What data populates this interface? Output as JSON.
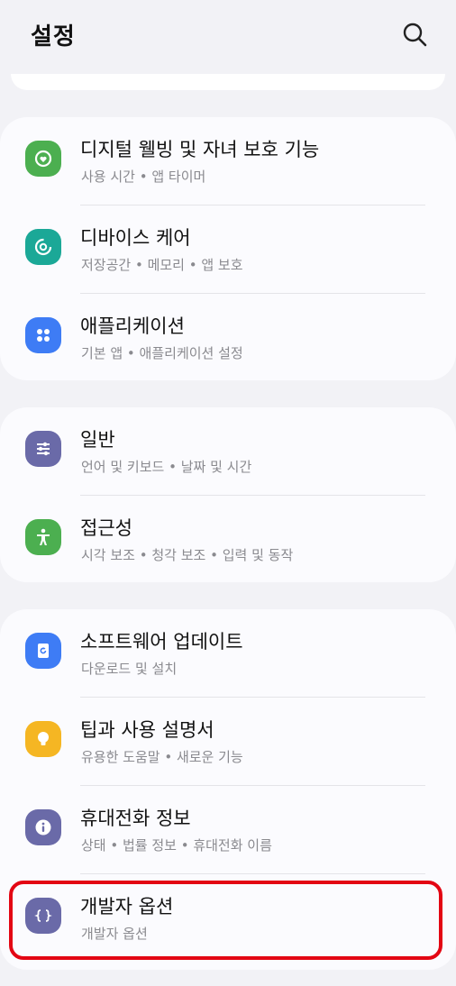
{
  "header": {
    "title": "설정"
  },
  "groups": [
    {
      "items": [
        {
          "title": "디지털 웰빙 및 자녀 보호 기능",
          "subtitle": "사용 시간  •  앱 타이머",
          "icon": "digital-wellbeing-icon",
          "color": "#4caf50"
        },
        {
          "title": "디바이스 케어",
          "subtitle": "저장공간  •  메모리  •  앱 보호",
          "icon": "device-care-icon",
          "color": "#1ba897"
        },
        {
          "title": "애플리케이션",
          "subtitle": "기본 앱  •  애플리케이션 설정",
          "icon": "apps-icon",
          "color": "#3e7cf5"
        }
      ]
    },
    {
      "items": [
        {
          "title": "일반",
          "subtitle": "언어 및 키보드  •  날짜 및 시간",
          "icon": "sliders-icon",
          "color": "#6a6aa8"
        },
        {
          "title": "접근성",
          "subtitle": "시각 보조  •  청각 보조  •  입력 및 동작",
          "icon": "accessibility-icon",
          "color": "#4caf50"
        }
      ]
    },
    {
      "items": [
        {
          "title": "소프트웨어 업데이트",
          "subtitle": "다운로드 및 설치",
          "icon": "software-update-icon",
          "color": "#3e7cf5"
        },
        {
          "title": "팁과 사용 설명서",
          "subtitle": "유용한 도움말  •  새로운 기능",
          "icon": "lightbulb-icon",
          "color": "#f5b623"
        },
        {
          "title": "휴대전화 정보",
          "subtitle": "상태  •  법률 정보  •  휴대전화 이름",
          "icon": "info-icon",
          "color": "#6a6aa8"
        },
        {
          "title": "개발자 옵션",
          "subtitle": "개발자 옵션",
          "icon": "developer-options-icon",
          "color": "#6a6aa8"
        }
      ]
    }
  ],
  "highlight_color": "#e30613"
}
